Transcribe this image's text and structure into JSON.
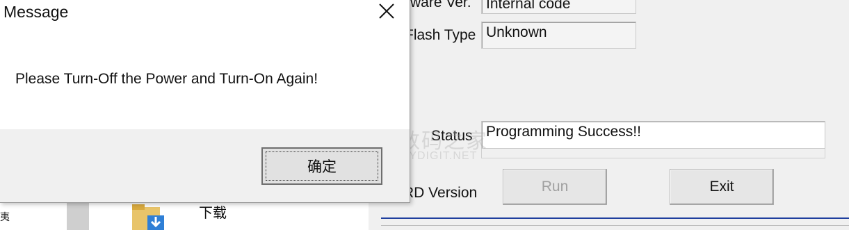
{
  "dialog": {
    "title": "Message",
    "message": "Please Turn-Off the Power and Turn-On Again!",
    "ok_label": "确定"
  },
  "app": {
    "firmware_label": "ware Ver.",
    "firmware_value": "Internal code",
    "flash_type_label": "Flash Type",
    "flash_type_value": "Unknown",
    "status_label": "Status",
    "status_value": "Programming Success!!",
    "rd_version_label": "RD Version",
    "run_label": "Run",
    "exit_label": "Exit"
  },
  "explorer": {
    "folder_label": "下载",
    "left_glyph": "夷"
  },
  "watermark": {
    "cn": "数码之家",
    "en": "MYDIGIT.NET"
  }
}
